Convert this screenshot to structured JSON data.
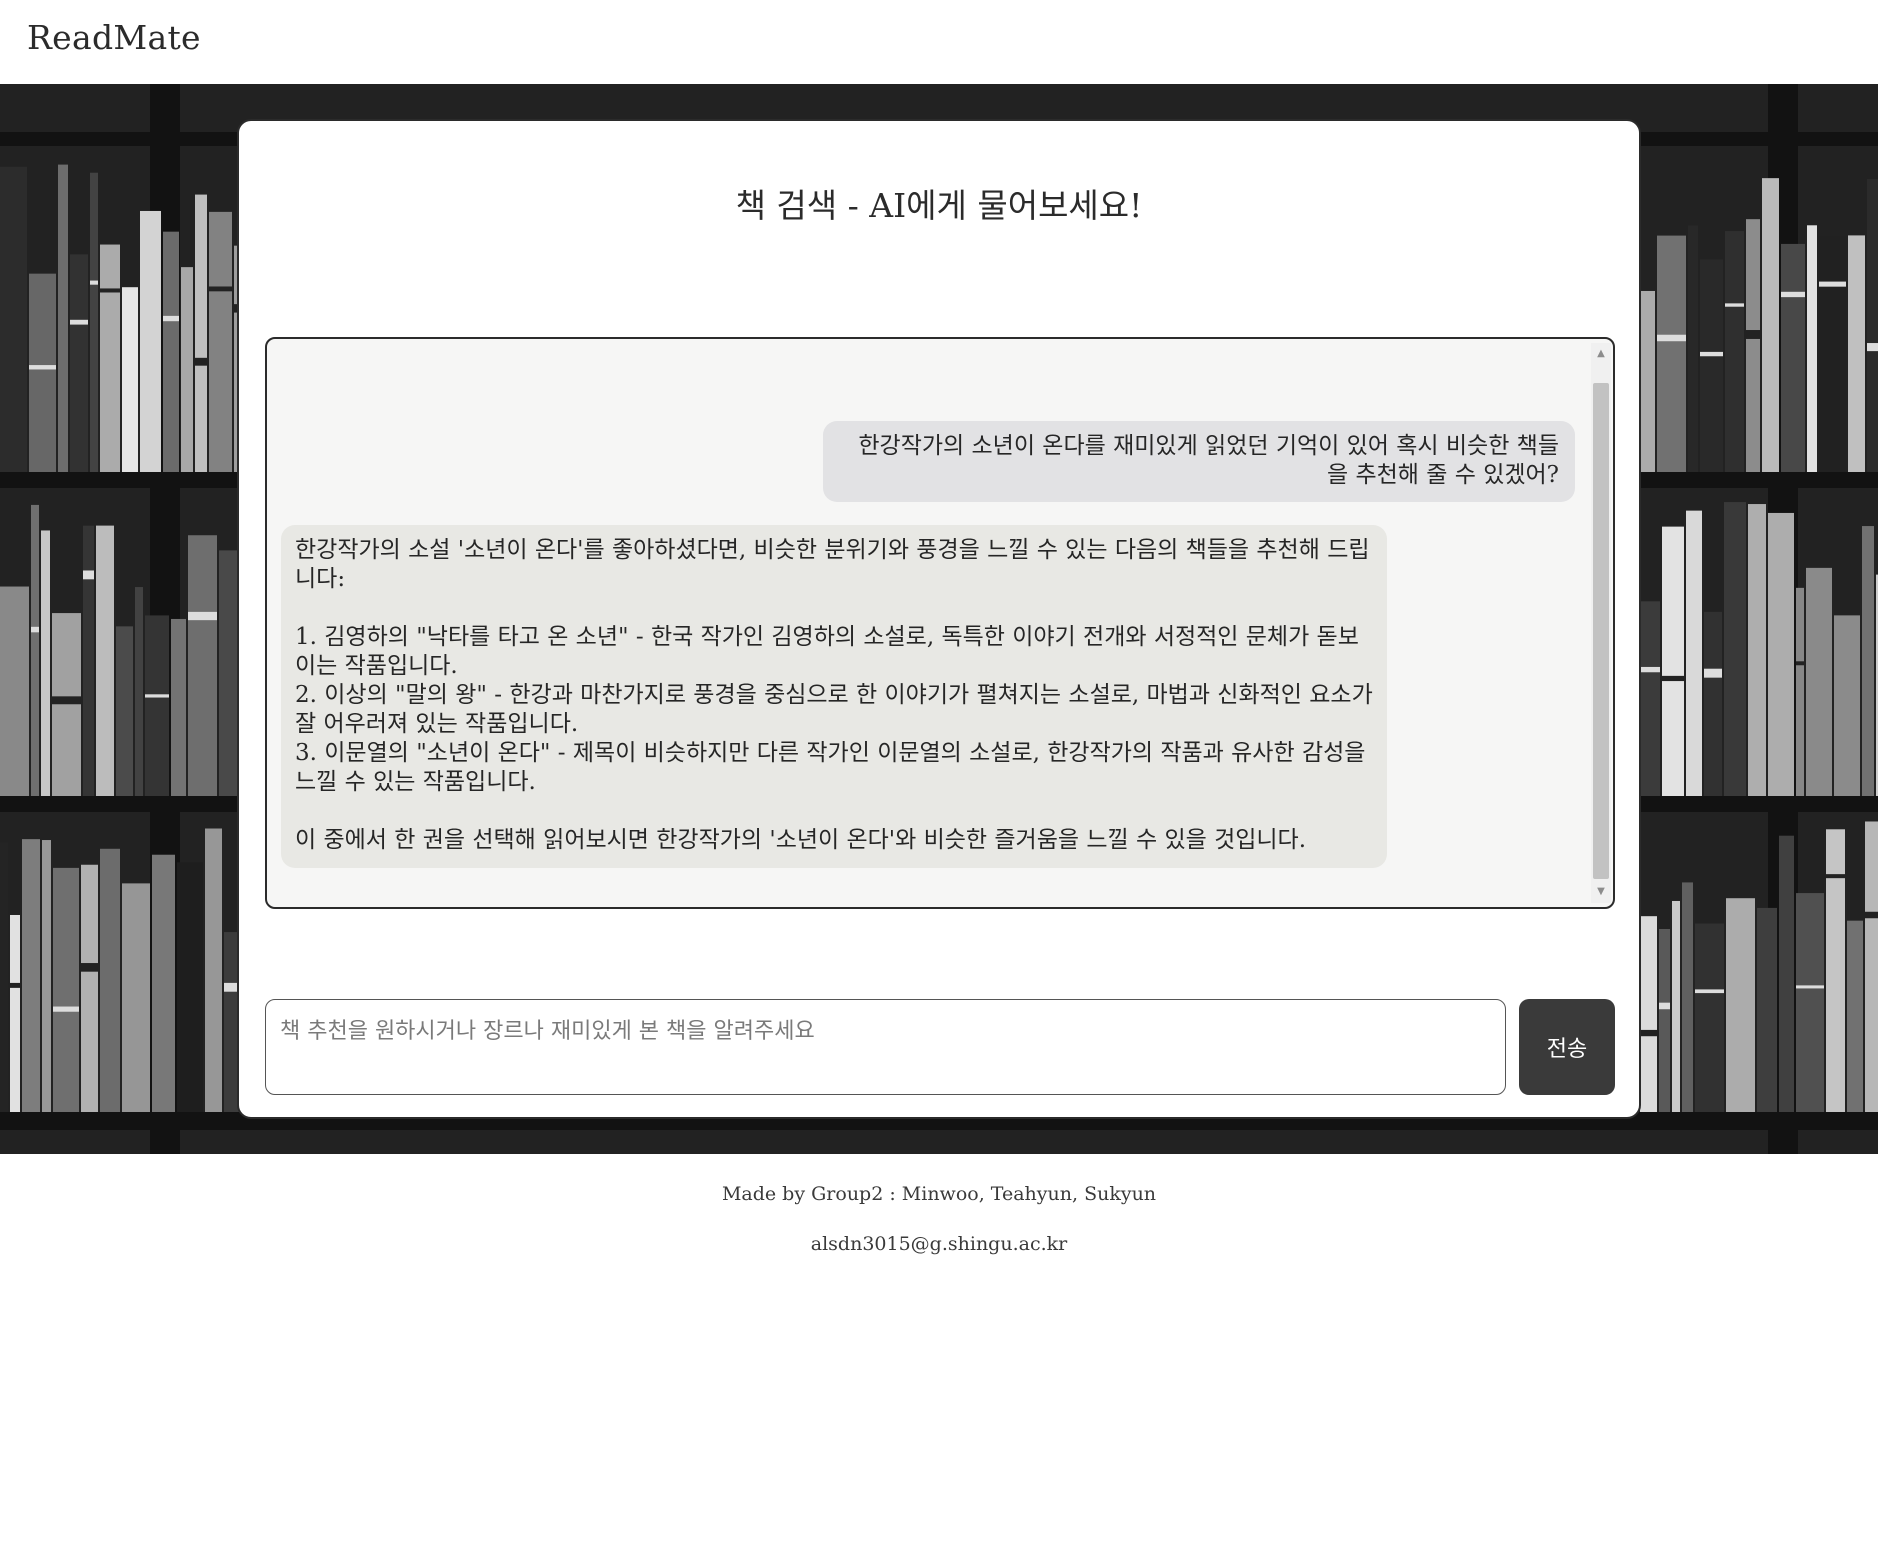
{
  "header": {
    "logo": "ReadMate"
  },
  "card": {
    "title": "책 검색 - AI에게 물어보세요!"
  },
  "chat": {
    "messages": [
      {
        "role": "user",
        "text": "한강작가의 소년이 온다를 재미있게 읽었던 기억이 있어 혹시 비슷한 책들을 추천해 줄 수 있겠어?"
      },
      {
        "role": "assistant",
        "text": "한강작가의 소설 '소년이 온다'를 좋아하셨다면, 비슷한 분위기와 풍경을 느낄 수 있는 다음의 책들을 추천해 드립니다:\n\n1. 김영하의 \"낙타를 타고 온 소년\" - 한국 작가인 김영하의 소설로, 독특한 이야기 전개와 서정적인 문체가 돋보이는 작품입니다.\n2. 이상의 \"말의 왕\" - 한강과 마찬가지로 풍경을 중심으로 한 이야기가 펼쳐지는 소설로, 마법과 신화적인 요소가 잘 어우러져 있는 작품입니다.\n3. 이문열의 \"소년이 온다\" - 제목이 비슷하지만 다른 작가인 이문열의 소설로, 한강작가의 작품과 유사한 감성을 느낄 수 있는 작품입니다.\n\n이 중에서 한 권을 선택해 읽어보시면 한강작가의 '소년이 온다'와 비슷한 즐거움을 느낄 수 있을 것입니다."
      }
    ]
  },
  "input": {
    "placeholder": "책 추천을 원하시거나 장르나 재미있게 본 책을 알려주세요",
    "value": ""
  },
  "send_button": {
    "label": "전송"
  },
  "footer": {
    "credit": "Made by Group2 : Minwoo, Teahyun, Sukyun",
    "email": "alsdn3015@g.shingu.ac.kr"
  },
  "colors": {
    "card_border": "#2b2b2b",
    "user_bubble": "#e2e2e4",
    "bot_bubble": "#e8e8e4",
    "send_button": "#3a3a3a",
    "chat_background": "#f6f6f5"
  },
  "icons": {
    "scroll_up": "scroll-up-arrow-icon",
    "scroll_down": "scroll-down-arrow-icon"
  }
}
